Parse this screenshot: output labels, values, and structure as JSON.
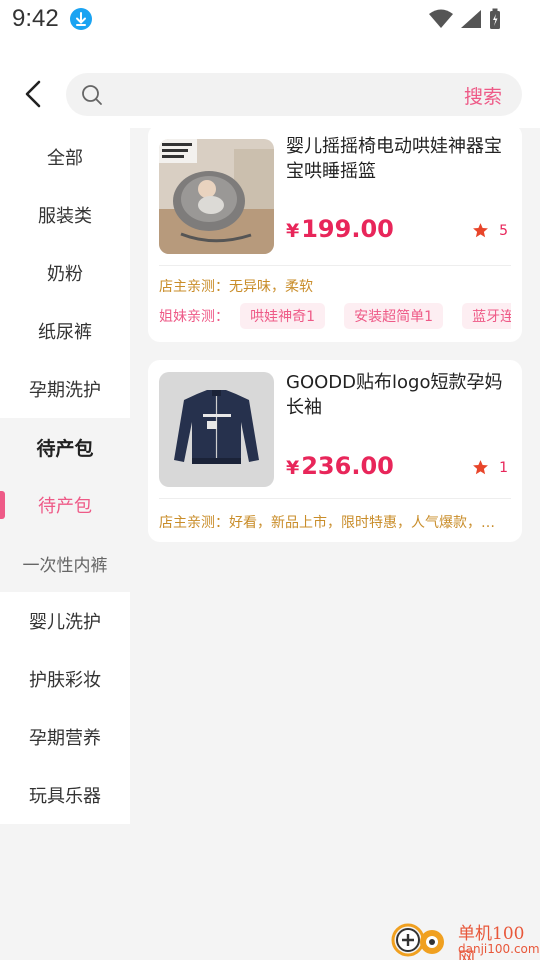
{
  "status_bar": {
    "time": "9:42",
    "icons": [
      "download-icon",
      "wifi-icon",
      "signal-icon",
      "battery-charging-icon"
    ]
  },
  "header": {
    "back_icon": "chevron-left-icon",
    "search_placeholder": "",
    "search_button": "搜索"
  },
  "sidebar": {
    "top_items": [
      {
        "label": "全部"
      },
      {
        "label": "服装类"
      },
      {
        "label": "奶粉"
      },
      {
        "label": "纸尿裤"
      },
      {
        "label": "孕期洗护"
      }
    ],
    "active_parent": {
      "label": "待产包"
    },
    "sub_items": [
      {
        "label": "待产包",
        "selected": true
      },
      {
        "label": "一次性内裤",
        "selected": false
      }
    ],
    "bottom_items": [
      {
        "label": "婴儿洗护"
      },
      {
        "label": "护肤彩妆"
      },
      {
        "label": "孕期营养"
      },
      {
        "label": "玩具乐器"
      }
    ]
  },
  "products": [
    {
      "title": "婴儿摇摇椅电动哄娃神器宝宝哄睡摇篮",
      "currency": "¥",
      "price": "199.00",
      "fav_count": "5",
      "review_label": "店主亲测：",
      "review": "无异味，柔软",
      "tags_label": "姐妹亲测：",
      "tags": [
        "哄娃神奇1",
        "安装超简单1",
        "蓝牙连接"
      ]
    },
    {
      "title": "GOODD贴布logo短款孕妈长袖",
      "currency": "¥",
      "price": "236.00",
      "fav_count": "1",
      "review_label": "店主亲测：",
      "review": "好看，新品上市，限时特惠，人气爆款，新品上市"
    }
  ],
  "watermark": {
    "line1": "单机100网",
    "line2": "danji100.com"
  },
  "colors": {
    "accent": "#ee5a87",
    "price": "#e8265a",
    "review": "#c98d2a",
    "background": "#f4f4f4"
  }
}
